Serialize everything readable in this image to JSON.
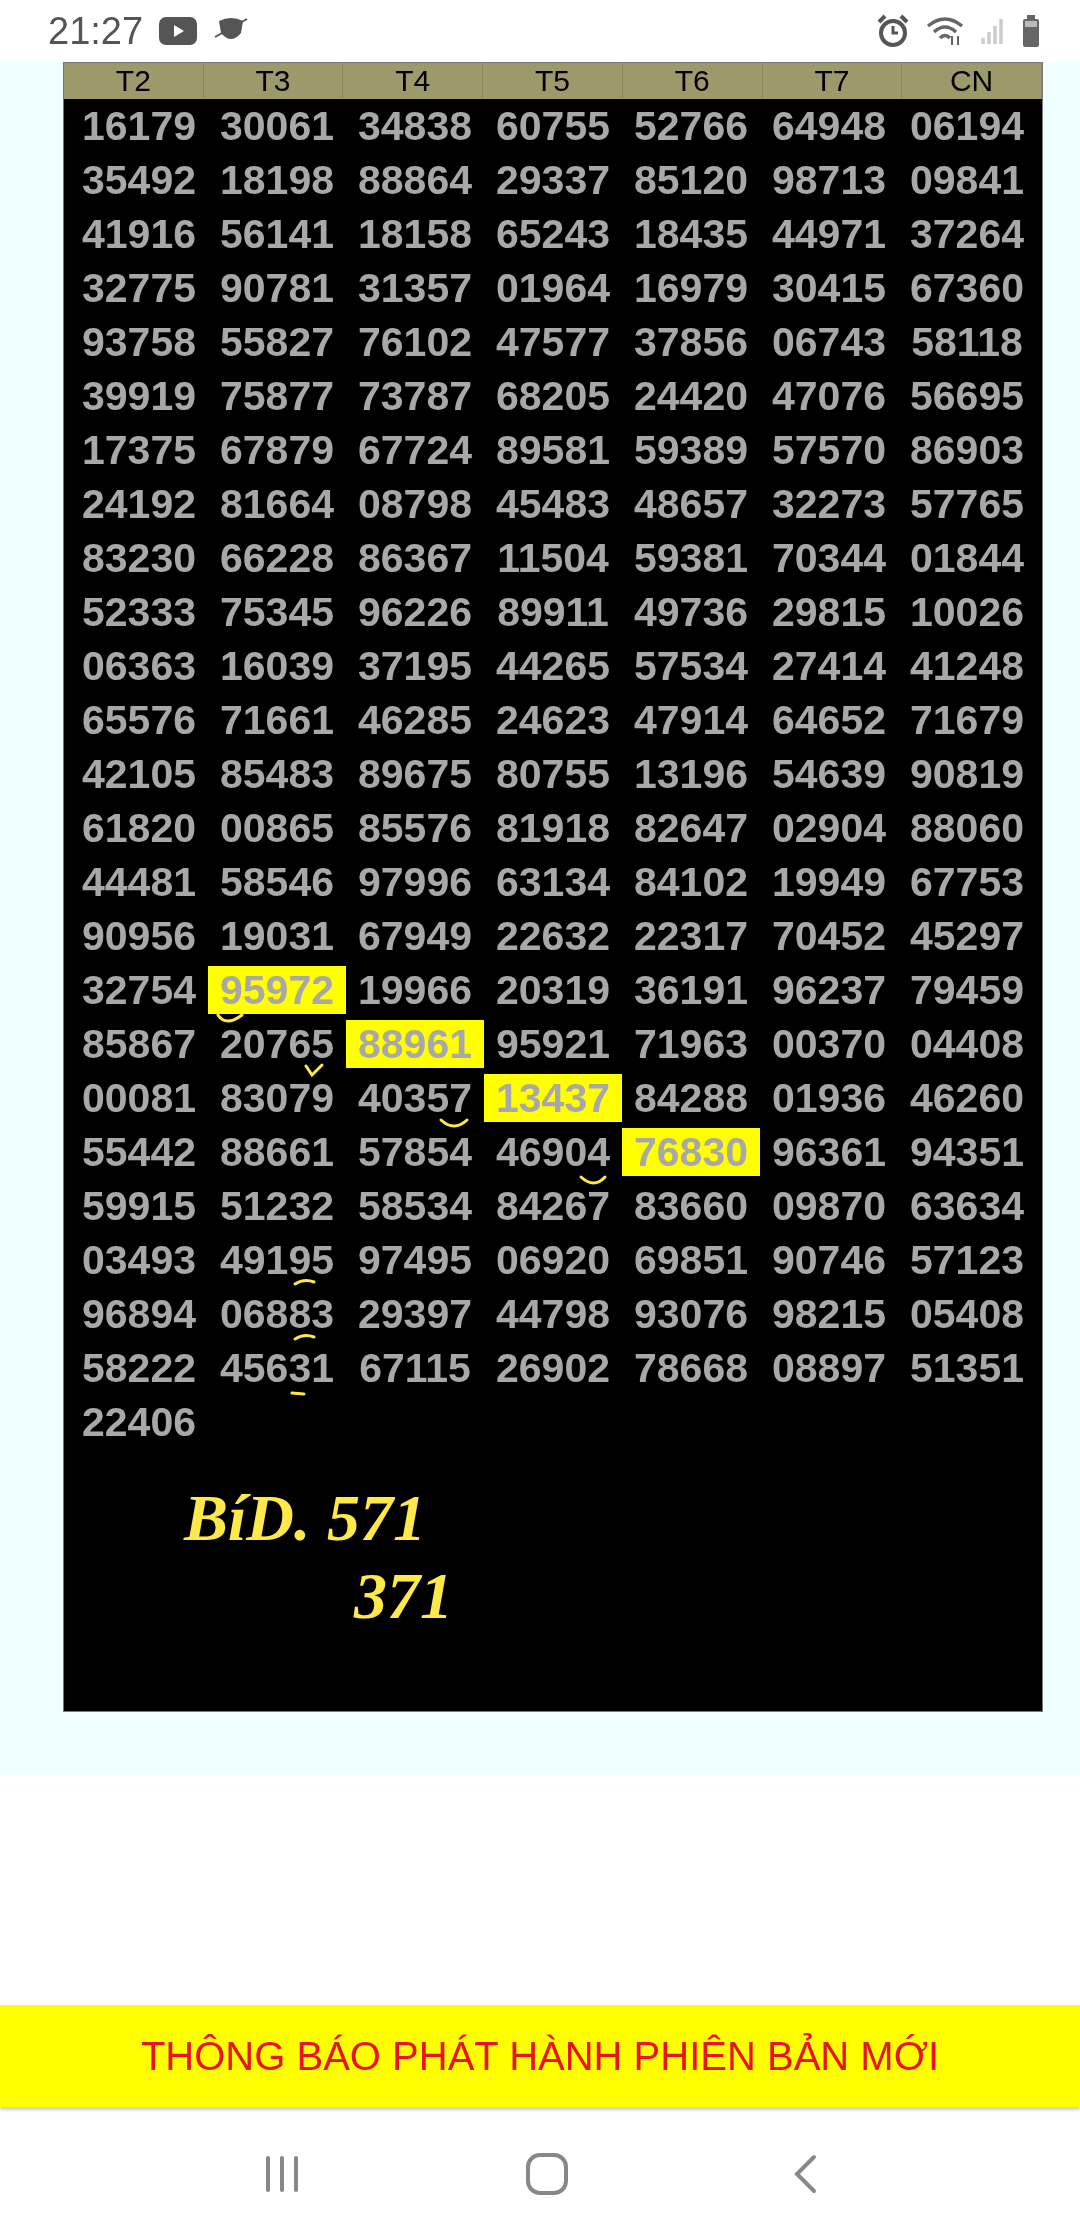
{
  "status_bar": {
    "time": "21:27"
  },
  "table": {
    "columns": [
      "T2",
      "T3",
      "T4",
      "T5",
      "T6",
      "T7",
      "CN"
    ],
    "rows": [
      [
        "16179",
        "30061",
        "34838",
        "60755",
        "52766",
        "64948",
        "06194"
      ],
      [
        "35492",
        "18198",
        "88864",
        "29337",
        "85120",
        "98713",
        "09841"
      ],
      [
        "41916",
        "56141",
        "18158",
        "65243",
        "18435",
        "44971",
        "37264"
      ],
      [
        "32775",
        "90781",
        "31357",
        "01964",
        "16979",
        "30415",
        "67360"
      ],
      [
        "93758",
        "55827",
        "76102",
        "47577",
        "37856",
        "06743",
        "58118"
      ],
      [
        "39919",
        "75877",
        "73787",
        "68205",
        "24420",
        "47076",
        "56695"
      ],
      [
        "17375",
        "67879",
        "67724",
        "89581",
        "59389",
        "57570",
        "86903"
      ],
      [
        "24192",
        "81664",
        "08798",
        "45483",
        "48657",
        "32273",
        "57765"
      ],
      [
        "83230",
        "66228",
        "86367",
        "11504",
        "59381",
        "70344",
        "01844"
      ],
      [
        "52333",
        "75345",
        "96226",
        "89911",
        "49736",
        "29815",
        "10026"
      ],
      [
        "06363",
        "16039",
        "37195",
        "44265",
        "57534",
        "27414",
        "41248"
      ],
      [
        "65576",
        "71661",
        "46285",
        "24623",
        "47914",
        "64652",
        "71679"
      ],
      [
        "42105",
        "85483",
        "89675",
        "80755",
        "13196",
        "54639",
        "90819"
      ],
      [
        "61820",
        "00865",
        "85576",
        "81918",
        "82647",
        "02904",
        "88060"
      ],
      [
        "44481",
        "58546",
        "97996",
        "63134",
        "84102",
        "19949",
        "67753"
      ],
      [
        "90956",
        "19031",
        "67949",
        "22632",
        "22317",
        "70452",
        "45297"
      ],
      [
        "32754",
        {
          "text": "95972",
          "highlighted": true
        },
        "19966",
        "20319",
        "36191",
        "96237",
        "79459"
      ],
      [
        "85867",
        "20765",
        {
          "text": "88961",
          "highlighted": true
        },
        "95921",
        "71963",
        "00370",
        "04408"
      ],
      [
        "00081",
        "83079",
        "40357",
        {
          "text": "13437",
          "highlighted": true
        },
        "84288",
        "01936",
        "46260"
      ],
      [
        "55442",
        "88661",
        "57854",
        "46904",
        {
          "text": "76830",
          "highlighted": true
        },
        "96361",
        "94351"
      ],
      [
        "59915",
        "51232",
        "58534",
        "84267",
        "83660",
        "09870",
        "63634"
      ],
      [
        "03493",
        "49195",
        "97495",
        "06920",
        "69851",
        "90746",
        "57123"
      ],
      [
        "96894",
        "06883",
        "29397",
        "44798",
        "93076",
        "98215",
        "05408"
      ],
      [
        "58222",
        "45631",
        "67115",
        "26902",
        "78668",
        "08897",
        "51351"
      ],
      [
        "22406"
      ]
    ]
  },
  "handwriting": [
    "BíD. 571",
    "371"
  ],
  "banner": "THÔNG BÁO PHÁT HÀNH PHIÊN BẢN MỚI"
}
